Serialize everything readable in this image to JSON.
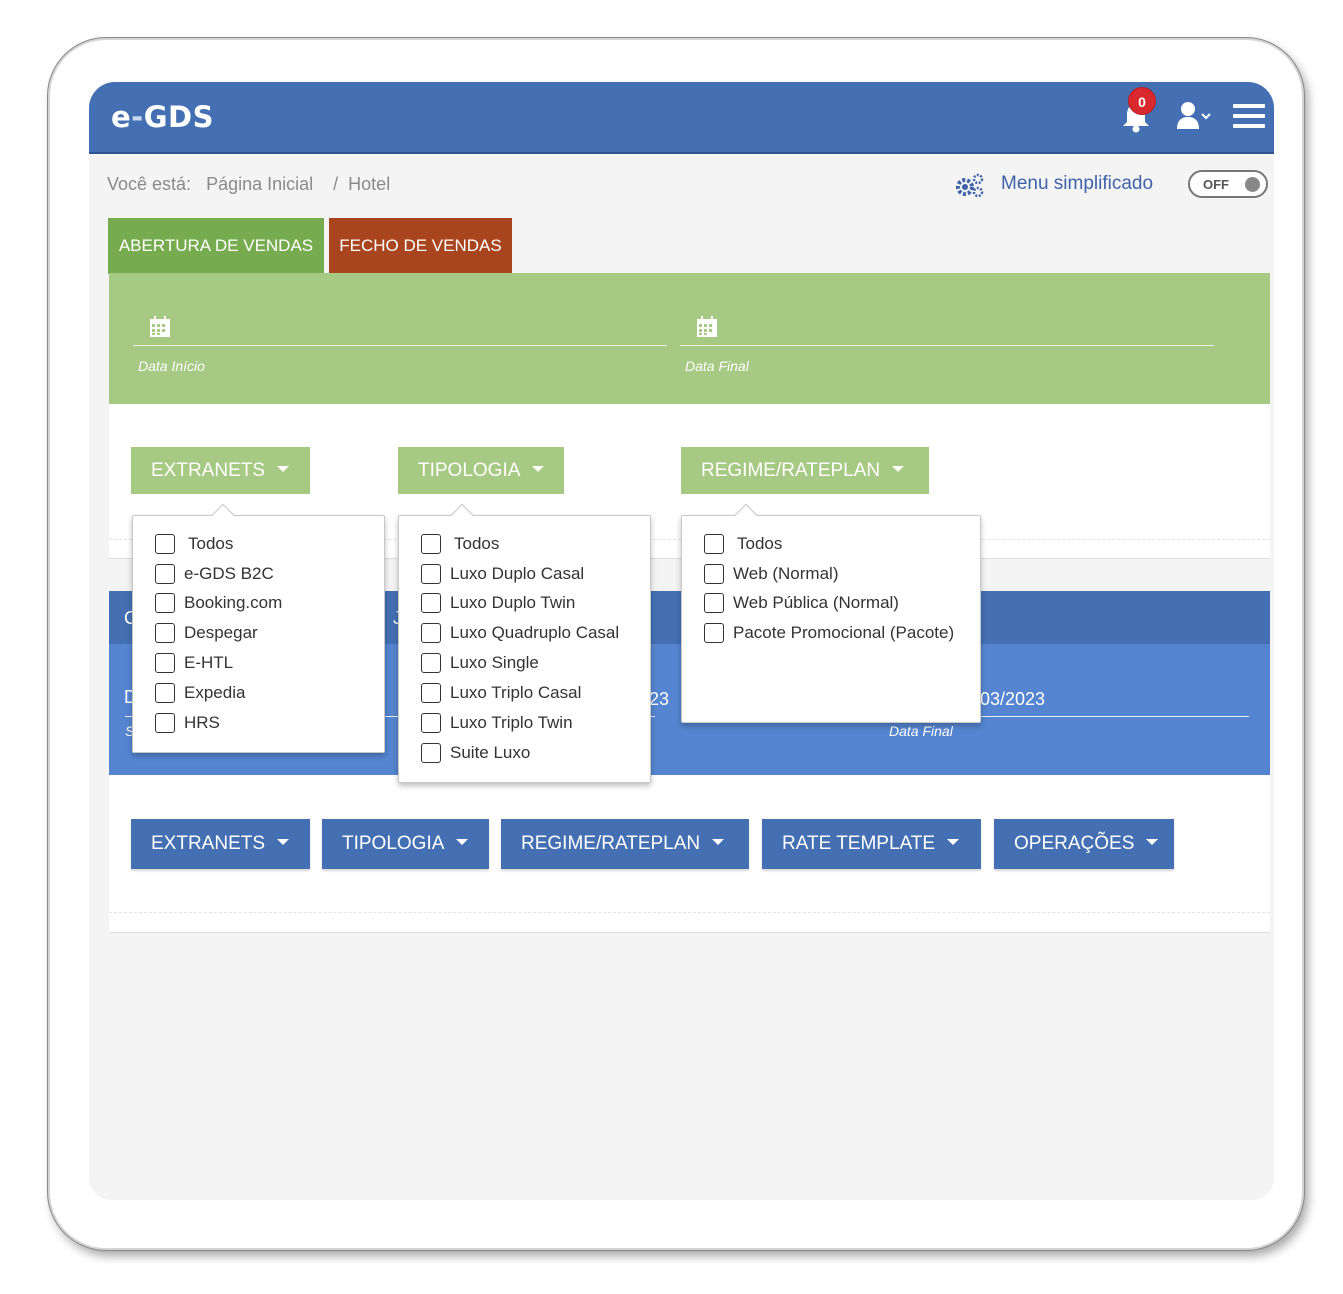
{
  "header": {
    "logo_prefix": "e",
    "logo_dash": "-",
    "logo_main": "GDS",
    "notification_count": "0",
    "accent_color": "#4470b3",
    "badge_color": "#d9292f"
  },
  "breadcrumb": {
    "prefix": "Você está:",
    "home": "Página Inicial",
    "separator": "/",
    "current": "Hotel"
  },
  "simplified_menu": {
    "label": "Menu simplificado",
    "toggle_state": "OFF"
  },
  "tabs": {
    "open_sales": "ABERTURA DE VENDAS",
    "close_sales": "FECHO DE VENDAS"
  },
  "green_panel": {
    "start_date_label": "Data Início",
    "end_date_label": "Data Final",
    "color": "#a6c983"
  },
  "green_filters": {
    "extranets": "EXTRANETS",
    "tipologia": "TIPOLOGIA",
    "regime": "REGIME/RATEPLAN"
  },
  "extranets_dropdown": {
    "items": [
      "Todos",
      "e-GDS B2C",
      "Booking.com",
      "Despegar",
      "E-HTL",
      "Expedia",
      "HRS"
    ]
  },
  "tipologia_dropdown": {
    "items": [
      "Todos",
      "Luxo Duplo Casal",
      "Luxo Duplo Twin",
      "Luxo Quadruplo Casal",
      "Luxo Single",
      "Luxo Triplo Casal",
      "Luxo Triplo Twin",
      "Suite Luxo"
    ]
  },
  "regime_dropdown": {
    "items": [
      "Todos",
      "Web (Normal)",
      "Web Pública (Normal)",
      "Pacote Promocional (Pacote)"
    ]
  },
  "blue_panel": {
    "head_left_fragment": "C",
    "head_mid_fragment": "J",
    "body_left_fragment": "D",
    "body_left_small_fragment": "S",
    "date_mid_fragment": "23",
    "date_end_fragment": "03/2023",
    "end_date_label": "Data Final"
  },
  "blue_buttons": {
    "extranets": "EXTRANETS",
    "tipologia": "TIPOLOGIA",
    "regime": "REGIME/RATEPLAN",
    "rate_template": "RATE TEMPLATE",
    "operacoes": "OPERAÇÕES"
  }
}
